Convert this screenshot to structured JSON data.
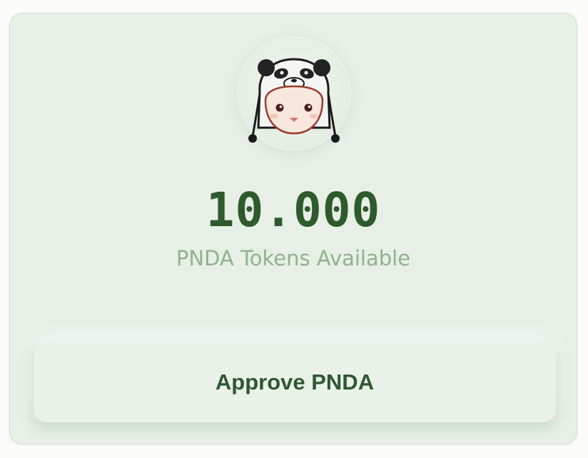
{
  "token": {
    "amount": "10.000",
    "description": "PNDA Tokens Available",
    "avatar_icon": "panda-hat-icon"
  },
  "actions": {
    "approve_label": "Approve PNDA"
  },
  "colors": {
    "card_background": "#e7efe6",
    "amount_text": "#2e5a2c",
    "subtitle_text": "#8fb38c",
    "button_text": "#2f5734"
  }
}
